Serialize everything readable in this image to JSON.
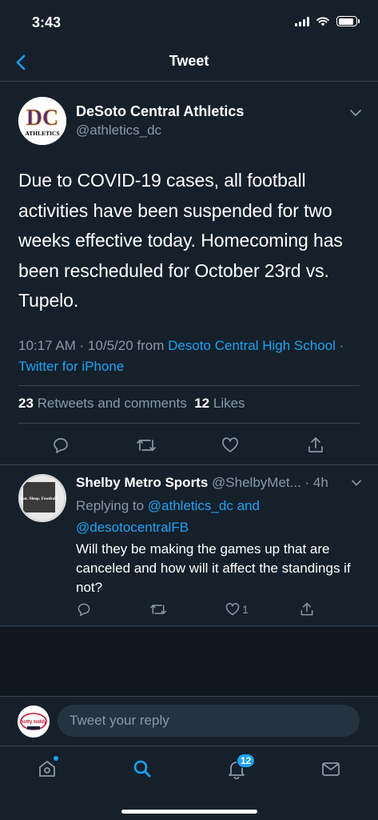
{
  "status_bar": {
    "time": "3:43"
  },
  "nav": {
    "title": "Tweet"
  },
  "tweet": {
    "author_name": "DeSoto Central Athletics",
    "author_handle": "@athletics_dc",
    "avatar_letters": "DC",
    "avatar_caption": "ATHLETICS",
    "text": "Due to COVID-19 cases, all football activities have been suspended for two weeks effective today. Homecoming has been rescheduled for October 23rd vs. Tupelo.",
    "timestamp": "10:17 AM · 10/5/20",
    "from_label": "from",
    "source": "Desoto Central High School · Twitter for iPhone",
    "retweets_count": "23",
    "retweets_label": "Retweets and comments",
    "likes_count": "12",
    "likes_label": "Likes"
  },
  "reply": {
    "author_name": "Shelby Metro Sports",
    "author_handle": "@ShelbyMet...",
    "time": "· 4h",
    "avatar_text": "Eat. Sleep. Football.",
    "replying_prefix": "Replying to",
    "replying_to_1": "@athletics_dc",
    "replying_and": "and",
    "replying_to_2": "@desotocentralFB",
    "text": "Will they be making the games up that are canceled and how will it affect the standings if not?",
    "like_count": "1"
  },
  "composer": {
    "placeholder": "Tweet your reply",
    "avatar_text": "hotty toddy"
  },
  "tab_bar": {
    "notifications_badge": "12"
  },
  "colors": {
    "background": "#15202b",
    "accent": "#1da1f2",
    "muted": "#8899a6",
    "divider": "#38444d"
  },
  "icons": [
    "back-chevron-icon",
    "caret-down-icon",
    "reply-icon",
    "retweet-icon",
    "heart-icon",
    "share-icon",
    "home-icon",
    "search-icon",
    "bell-icon",
    "mail-icon",
    "signal-icon",
    "wifi-icon",
    "battery-icon"
  ]
}
